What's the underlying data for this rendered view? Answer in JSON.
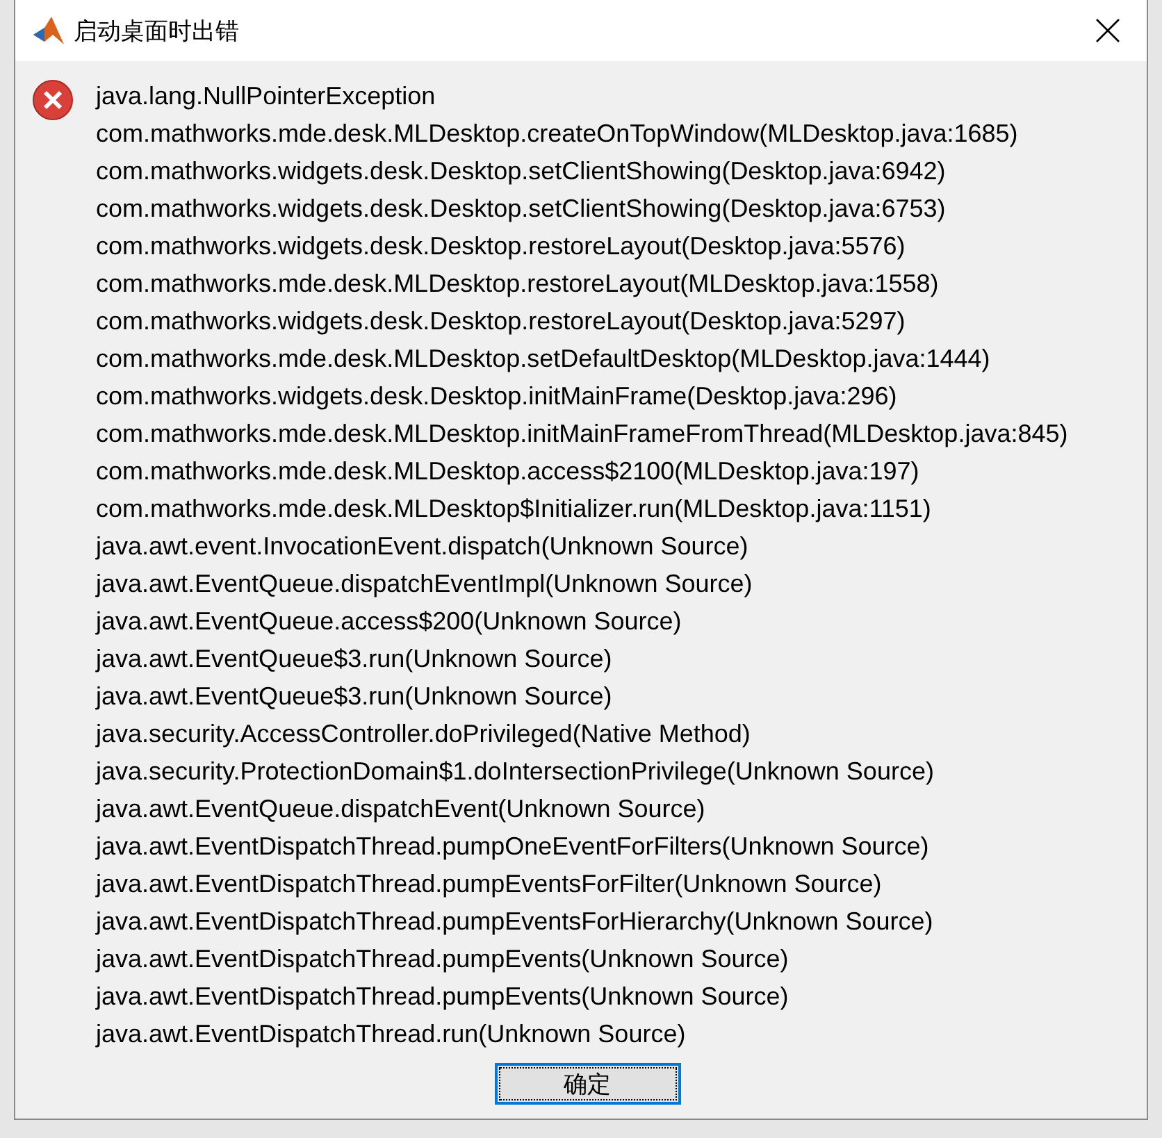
{
  "window": {
    "title": "启动桌面时出错"
  },
  "message_lines": [
    "java.lang.NullPointerException",
    "com.mathworks.mde.desk.MLDesktop.createOnTopWindow(MLDesktop.java:1685)",
    "com.mathworks.widgets.desk.Desktop.setClientShowing(Desktop.java:6942)",
    "com.mathworks.widgets.desk.Desktop.setClientShowing(Desktop.java:6753)",
    "com.mathworks.widgets.desk.Desktop.restoreLayout(Desktop.java:5576)",
    "com.mathworks.mde.desk.MLDesktop.restoreLayout(MLDesktop.java:1558)",
    "com.mathworks.widgets.desk.Desktop.restoreLayout(Desktop.java:5297)",
    "com.mathworks.mde.desk.MLDesktop.setDefaultDesktop(MLDesktop.java:1444)",
    "com.mathworks.widgets.desk.Desktop.initMainFrame(Desktop.java:296)",
    "com.mathworks.mde.desk.MLDesktop.initMainFrameFromThread(MLDesktop.java:845)",
    "com.mathworks.mde.desk.MLDesktop.access$2100(MLDesktop.java:197)",
    "com.mathworks.mde.desk.MLDesktop$Initializer.run(MLDesktop.java:1151)",
    "java.awt.event.InvocationEvent.dispatch(Unknown Source)",
    "java.awt.EventQueue.dispatchEventImpl(Unknown Source)",
    "java.awt.EventQueue.access$200(Unknown Source)",
    "java.awt.EventQueue$3.run(Unknown Source)",
    "java.awt.EventQueue$3.run(Unknown Source)",
    "java.security.AccessController.doPrivileged(Native Method)",
    "java.security.ProtectionDomain$1.doIntersectionPrivilege(Unknown Source)",
    "java.awt.EventQueue.dispatchEvent(Unknown Source)",
    "java.awt.EventDispatchThread.pumpOneEventForFilters(Unknown Source)",
    "java.awt.EventDispatchThread.pumpEventsForFilter(Unknown Source)",
    "java.awt.EventDispatchThread.pumpEventsForHierarchy(Unknown Source)",
    "java.awt.EventDispatchThread.pumpEvents(Unknown Source)",
    "java.awt.EventDispatchThread.pumpEvents(Unknown Source)",
    "java.awt.EventDispatchThread.run(Unknown Source)"
  ],
  "buttons": [
    {
      "label": "确定"
    }
  ]
}
